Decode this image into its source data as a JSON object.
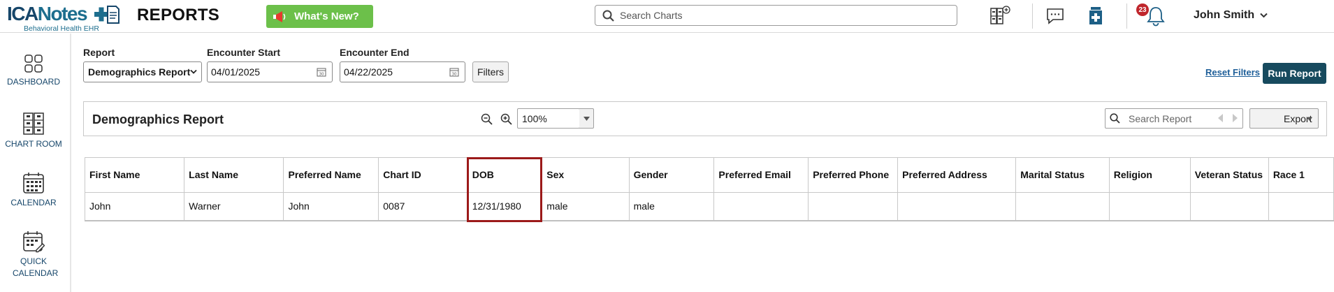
{
  "app": {
    "logo_text_main": "ICANotes",
    "logo_text_ica": "ICA",
    "logo_text_notes": "Notes",
    "logo_subtitle": "Behavioral Health EHR",
    "page_heading": "REPORTS",
    "whats_new_label": "What's New?",
    "search_placeholder": "Search Charts",
    "notification_count": "23",
    "user_name": "John Smith",
    "brand_color": "#16466a",
    "accent_green": "#6cc04a",
    "run_button_color": "#174a5e",
    "highlight_color": "#9c1a1a"
  },
  "sidebar": {
    "items": [
      {
        "label": "DASHBOARD",
        "icon": "dashboard-icon"
      },
      {
        "label": "CHART ROOM",
        "icon": "chart-room-icon"
      },
      {
        "label": "CALENDAR",
        "icon": "calendar-icon"
      },
      {
        "label": "QUICK CALENDAR",
        "icon": "quick-calendar-icon"
      }
    ]
  },
  "filters": {
    "report_label": "Report",
    "report_value": "Demographics Report",
    "start_label": "Encounter Start",
    "start_value": "04/01/2025",
    "end_label": "Encounter End",
    "end_value": "04/22/2025",
    "filters_button": "Filters",
    "reset_link": "Reset Filters",
    "run_button": "Run Report"
  },
  "report": {
    "title": "Demographics Report",
    "zoom_value": "100%",
    "search_placeholder": "Search Report",
    "export_label": "Export"
  },
  "table": {
    "headers": [
      "First Name",
      "Last Name",
      "Preferred Name",
      "Chart ID",
      "DOB",
      "Sex",
      "Gender",
      "Preferred Email",
      "Preferred Phone",
      "Preferred Address",
      "Marital Status",
      "Religion",
      "Veteran Status",
      "Race 1"
    ],
    "rows": [
      [
        "John",
        "Warner",
        "John",
        "0087",
        "12/31/1980",
        "male",
        "male",
        "",
        "",
        "",
        "",
        "",
        "",
        ""
      ]
    ],
    "highlighted_column": "DOB"
  }
}
